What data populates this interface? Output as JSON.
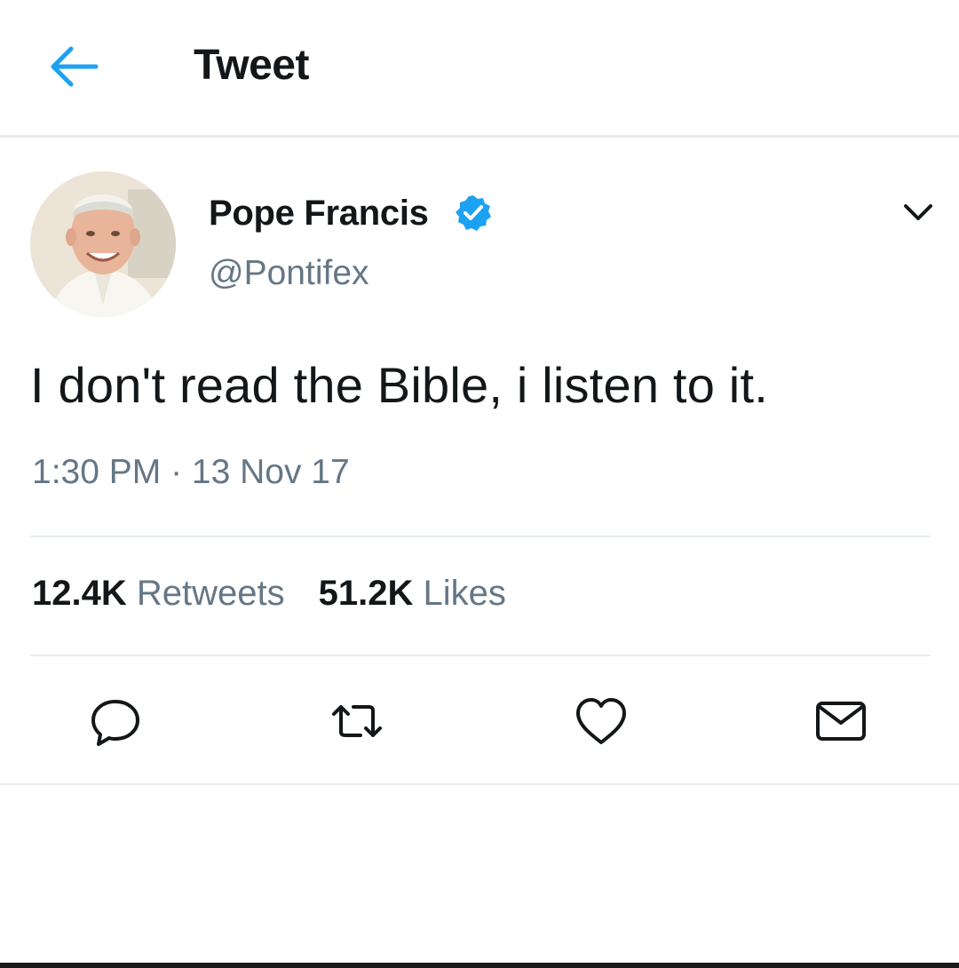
{
  "header": {
    "back_icon": "arrow-left-icon",
    "title": "Tweet"
  },
  "tweet": {
    "author": {
      "name": "Pope Francis",
      "handle": "@Pontifex",
      "verified": true,
      "avatar": "profile-photo"
    },
    "text": "I don't read the Bible, i listen to it.",
    "timestamp": "1:30 PM · 13 Nov 17",
    "stats": {
      "retweets_count": "12.4K",
      "retweets_label": "Retweets",
      "likes_count": "51.2K",
      "likes_label": "Likes"
    },
    "actions": [
      "reply-icon",
      "retweet-icon",
      "like-icon",
      "share-icon"
    ]
  },
  "colors": {
    "accent": "#1da1f2",
    "text_primary": "#14171a",
    "text_secondary": "#657786",
    "divider": "#e6ecf0"
  }
}
